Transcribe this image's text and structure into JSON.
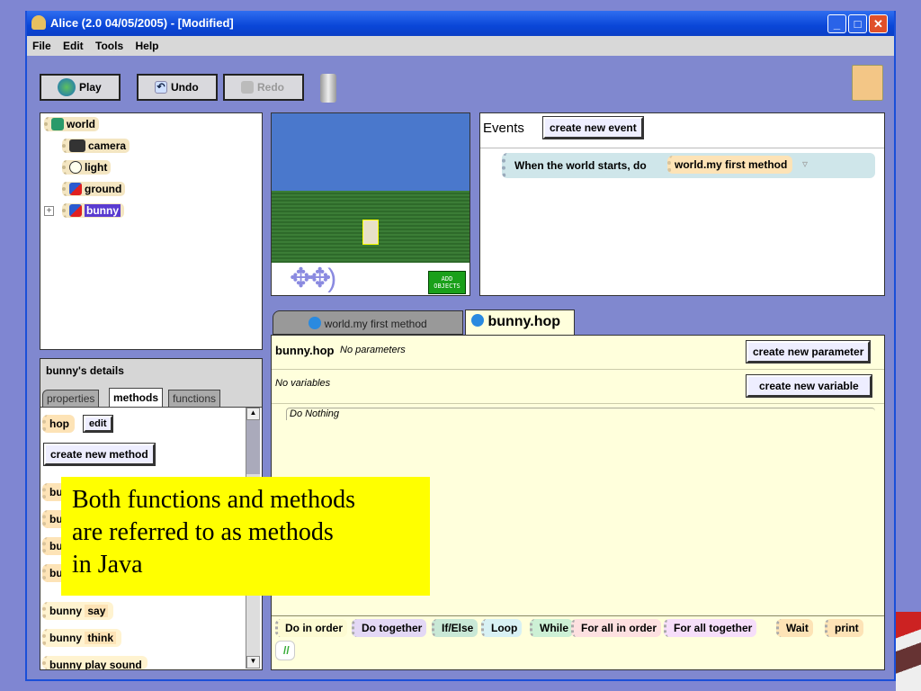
{
  "window": {
    "title": "Alice (2.0 04/05/2005) -  [Modified]",
    "min": "_",
    "max": "□",
    "close": "✕"
  },
  "menu": [
    "File",
    "Edit",
    "Tools",
    "Help"
  ],
  "toolbar": {
    "play": "Play",
    "undo": "Undo",
    "redo": "Redo"
  },
  "tree": {
    "items": [
      {
        "label": "world"
      },
      {
        "label": "camera"
      },
      {
        "label": "light"
      },
      {
        "label": "ground"
      },
      {
        "label": "bunny"
      }
    ],
    "expand": "+"
  },
  "details": {
    "title": "bunny's details",
    "tabs": [
      "properties",
      "methods",
      "functions"
    ],
    "method": "hop",
    "edit": "edit",
    "create_method": "create new method",
    "partial_items": [
      "bu",
      "bu",
      "bu",
      "bu"
    ],
    "items": [
      {
        "obj": "bunny",
        "method": "say"
      },
      {
        "obj": "bunny",
        "method": "think"
      },
      {
        "obj": "bunny",
        "method": "play sound"
      }
    ]
  },
  "scene": {
    "add_objects": "ADD OBJECTS"
  },
  "events": {
    "title": "Events",
    "create": "create new event",
    "event_text": "When the world starts,  do",
    "event_method": "world.my first method"
  },
  "editor": {
    "tabs": [
      "world.my first method",
      "bunny.hop"
    ],
    "method_name": "bunny.hop",
    "params": "No parameters",
    "create_param": "create new parameter",
    "vars": "No variables",
    "create_var": "create new variable",
    "body": "Do Nothing"
  },
  "controls": [
    {
      "label": "Do in order",
      "color": "#fdfbd2"
    },
    {
      "label": "Do together",
      "color": "#e3d8f5"
    },
    {
      "label": "If/Else",
      "color": "#c9e8d6"
    },
    {
      "label": "Loop",
      "color": "#d8f1f4"
    },
    {
      "label": "While",
      "color": "#cdf0d5"
    },
    {
      "label": "For all in order",
      "color": "#fde0e0"
    },
    {
      "label": "For all together",
      "color": "#f6defa"
    },
    {
      "label": "Wait",
      "color": "#fde3b6"
    },
    {
      "label": "print",
      "color": "#fde3b6"
    }
  ],
  "comment": "//",
  "callout": {
    "lines": [
      "Both functions and methods",
      "are referred to as  methods",
      "in Java"
    ]
  }
}
